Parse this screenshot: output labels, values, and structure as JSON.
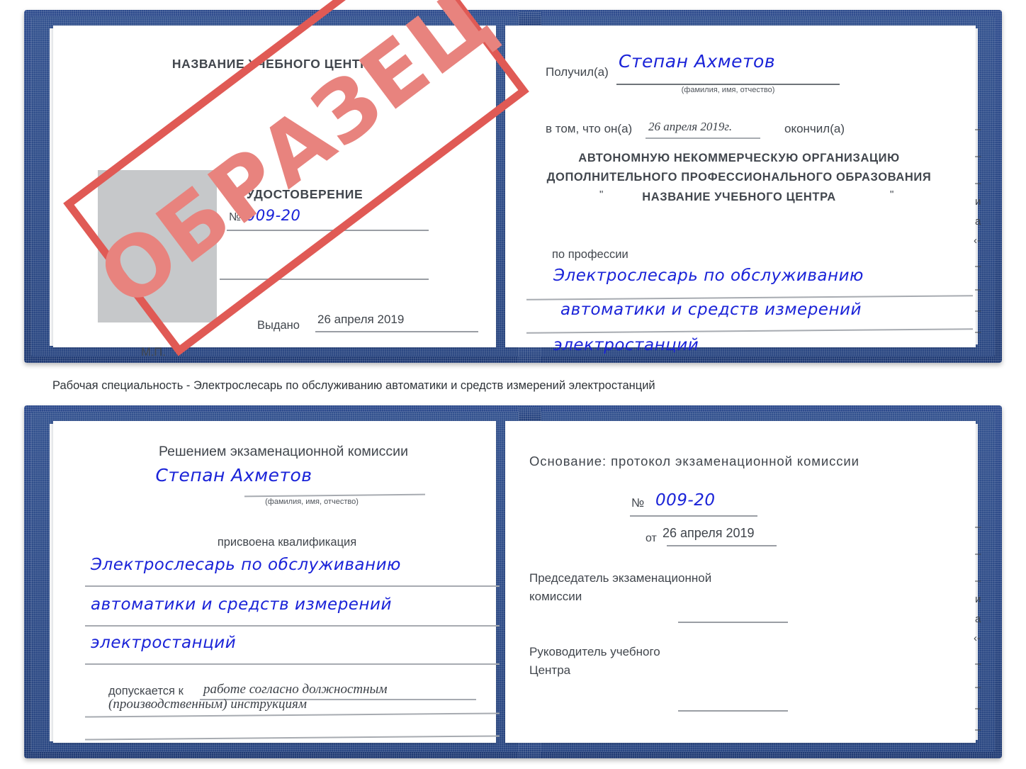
{
  "caption": "Рабочая специальность - Электрослесарь по обслуживанию автоматики и средств измерений электростанций",
  "stamp": {
    "text": "ОБРАЗЕЦ",
    "color": "#e05a55"
  },
  "certificate_top": {
    "left_page": {
      "center_name": "НАЗВАНИЕ УЧЕБНОГО ЦЕНТРА",
      "doc_title": "УДОСТОВЕРЕНИЕ",
      "number_label": "№",
      "number_value": "009-20",
      "issued_label": "Выдано",
      "issued_value": "26 апреля 2019",
      "seal_label": "М.П.",
      "photo_placeholder": ""
    },
    "right_page": {
      "received_label": "Получил(а)",
      "received_value": "Степан Ахметов",
      "name_hint": "(фамилия, имя, отчество)",
      "in_that_label": "в том, что он(а)",
      "completion_date": "26 апреля 2019г.",
      "finished_label": "окончил(а)",
      "org_line1": "АВТОНОМНУЮ НЕКОММЕРЧЕСКУЮ ОРГАНИЗАЦИЮ",
      "org_line2": "ДОПОЛНИТЕЛЬНОГО ПРОФЕССИОНАЛЬНОГО ОБРАЗОВАНИЯ",
      "org_quote_open": "\"",
      "org_name": "НАЗВАНИЕ УЧЕБНОГО ЦЕНТРА",
      "org_quote_close": "\"",
      "profession_label": "по профессии",
      "profession_line1": "Электрослесарь по обслуживанию",
      "profession_line2": "автоматики и средств измерений",
      "profession_line3": "электростанций",
      "edge_marks": [
        "–",
        "–",
        "–",
        "и",
        "а",
        "‹-",
        "–",
        "–",
        "–",
        "–"
      ]
    }
  },
  "certificate_bottom": {
    "left_page": {
      "decision_title": "Решением экзаменационной комиссии",
      "name_value": "Степан Ахметов",
      "name_hint": "(фамилия, имя, отчество)",
      "qualification_label": "присвоена квалификация",
      "qualification_line1": "Электрослесарь по обслуживанию",
      "qualification_line2": "автоматики и средств измерений",
      "qualification_line3": "электростанций",
      "allowed_label": "допускается к",
      "allowed_value_line1": "работе согласно должностным",
      "allowed_value_line2": "(производственным) инструкциям"
    },
    "right_page": {
      "basis_label": "Основание: протокол экзаменационной комиссии",
      "number_label": "№",
      "number_value": "009-20",
      "date_label": "от",
      "date_value": "26 апреля 2019",
      "chairman_line1": "Председатель экзаменационной",
      "chairman_line2": "комиссии",
      "head_line1": "Руководитель учебного",
      "head_line2": "Центра",
      "edge_marks": [
        "–",
        "–",
        "–",
        "и",
        "а",
        "‹-",
        "–",
        "–",
        "–",
        "–"
      ]
    }
  }
}
